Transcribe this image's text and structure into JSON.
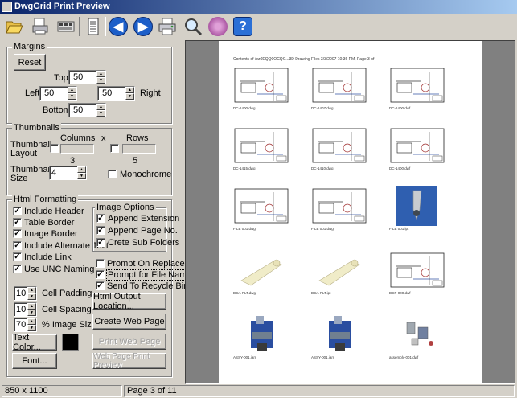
{
  "window": {
    "title": "DwgGrid Print Preview"
  },
  "toolbar": {
    "buttons": [
      {
        "name": "open-icon",
        "glyph": "📂"
      },
      {
        "name": "page-setup-icon",
        "glyph": ""
      },
      {
        "name": "print-icon",
        "glyph": ""
      },
      {
        "name": "single-page-icon",
        "glyph": ""
      },
      {
        "name": "previous-page-icon",
        "glyph": "◀"
      },
      {
        "name": "next-page-icon",
        "glyph": "▶"
      },
      {
        "name": "printer-icon",
        "glyph": ""
      },
      {
        "name": "zoom-icon",
        "glyph": "🔍"
      },
      {
        "name": "record-icon",
        "glyph": ""
      },
      {
        "name": "help-icon",
        "glyph": "?"
      }
    ],
    "colors": {
      "nav": "#1c5ec8",
      "help": "#2a6fd6",
      "record": "#c070b8"
    }
  },
  "margins": {
    "title": "Margins",
    "reset_label": "Reset",
    "top_label": "Top",
    "left_label": "Left",
    "right_label": "Right",
    "bottom_label": "Bottom",
    "top_value": ".50",
    "left_value": ".50",
    "right_value": ".50",
    "bottom_value": ".50"
  },
  "thumbnails": {
    "title": "Thumbnails",
    "layout_label": "Thumbnail Layout",
    "columns_label": "Columns",
    "x_label": "x",
    "rows_label": "Rows",
    "columns_value": "3",
    "rows_value": "5",
    "size_label": "Thumbnail Size",
    "size_value": "4",
    "monochrome_label": "Monochrome"
  },
  "html_formatting": {
    "title": "Html Formatting",
    "options": [
      {
        "label": "Include Header",
        "checked": "✓"
      },
      {
        "label": "Table Border",
        "checked": "✓"
      },
      {
        "label": "Image Border",
        "checked": "✓"
      },
      {
        "label": "Include Alternate Text",
        "checked": "✓"
      },
      {
        "label": "Include Link",
        "checked": "✓"
      },
      {
        "label": "Use UNC Naming",
        "checked": "✓"
      }
    ],
    "image_options": {
      "title": "Image Options",
      "items": [
        {
          "label": "Append Extension",
          "checked": "✓"
        },
        {
          "label": "Append Page No.",
          "checked": "✓"
        },
        {
          "label": "Crete Sub Folders",
          "checked": "✓"
        }
      ]
    },
    "prompt_on_replace": {
      "label": "Prompt On Replace",
      "checked": ""
    },
    "prompt_for_file_name": {
      "label": "Prompt for File Name",
      "checked": "✓"
    },
    "send_to_recycle_bin": {
      "label": "Send To Recycle Bin",
      "checked": "✓"
    },
    "cell_padding_label": "Cell Padding",
    "cell_padding_value": "10",
    "cell_spacing_label": "Cell Spacing",
    "cell_spacing_value": "10",
    "image_size_label": "% Image Size",
    "image_size_value": "70",
    "text_color_label": "Text Color...",
    "text_color_swatch": "#000000",
    "font_label": "Font...",
    "html_output_location_label": "Html Output Location...",
    "create_web_page_label": "Create Web Page",
    "print_web_page_label": "Print Web Page",
    "web_page_print_preview_label": "Web Page Print Preview"
  },
  "preview": {
    "header_text": "Contents of /ez0EQQ0OCQC...3D Drawing Files    3/3/2007 10:36 PM, Page 3 of",
    "thumbnails": [
      {
        "caption": "DC-1400.dwg",
        "kind": "drawing"
      },
      {
        "caption": "DC-1407.dwg",
        "kind": "drawing"
      },
      {
        "caption": "DC-1400.dwf",
        "kind": "drawing"
      },
      {
        "caption": "DC-1415.dwg",
        "kind": "drawing"
      },
      {
        "caption": "DC-1410.dwg",
        "kind": "drawing"
      },
      {
        "caption": "DC-1400.dwf",
        "kind": "drawing"
      },
      {
        "caption": "FILE 001.dwg",
        "kind": "drawing"
      },
      {
        "caption": "FILE 001.dwg",
        "kind": "drawing"
      },
      {
        "caption": "FILE 001.ipt",
        "kind": "part-blue"
      },
      {
        "caption": "DCA-PLT.dwg",
        "kind": "part-cream"
      },
      {
        "caption": "DCA-PLT.ipt",
        "kind": "part-cream"
      },
      {
        "caption": "DCF-000.dwf",
        "kind": "drawing"
      },
      {
        "caption": "ASSY-001.iam",
        "kind": "assembly"
      },
      {
        "caption": "ASSY-001.iam",
        "kind": "assembly"
      },
      {
        "caption": "assembly-001.dwf",
        "kind": "exploded"
      }
    ]
  },
  "status": {
    "size": "850 x 1100",
    "page": "Page 3 of 11"
  }
}
